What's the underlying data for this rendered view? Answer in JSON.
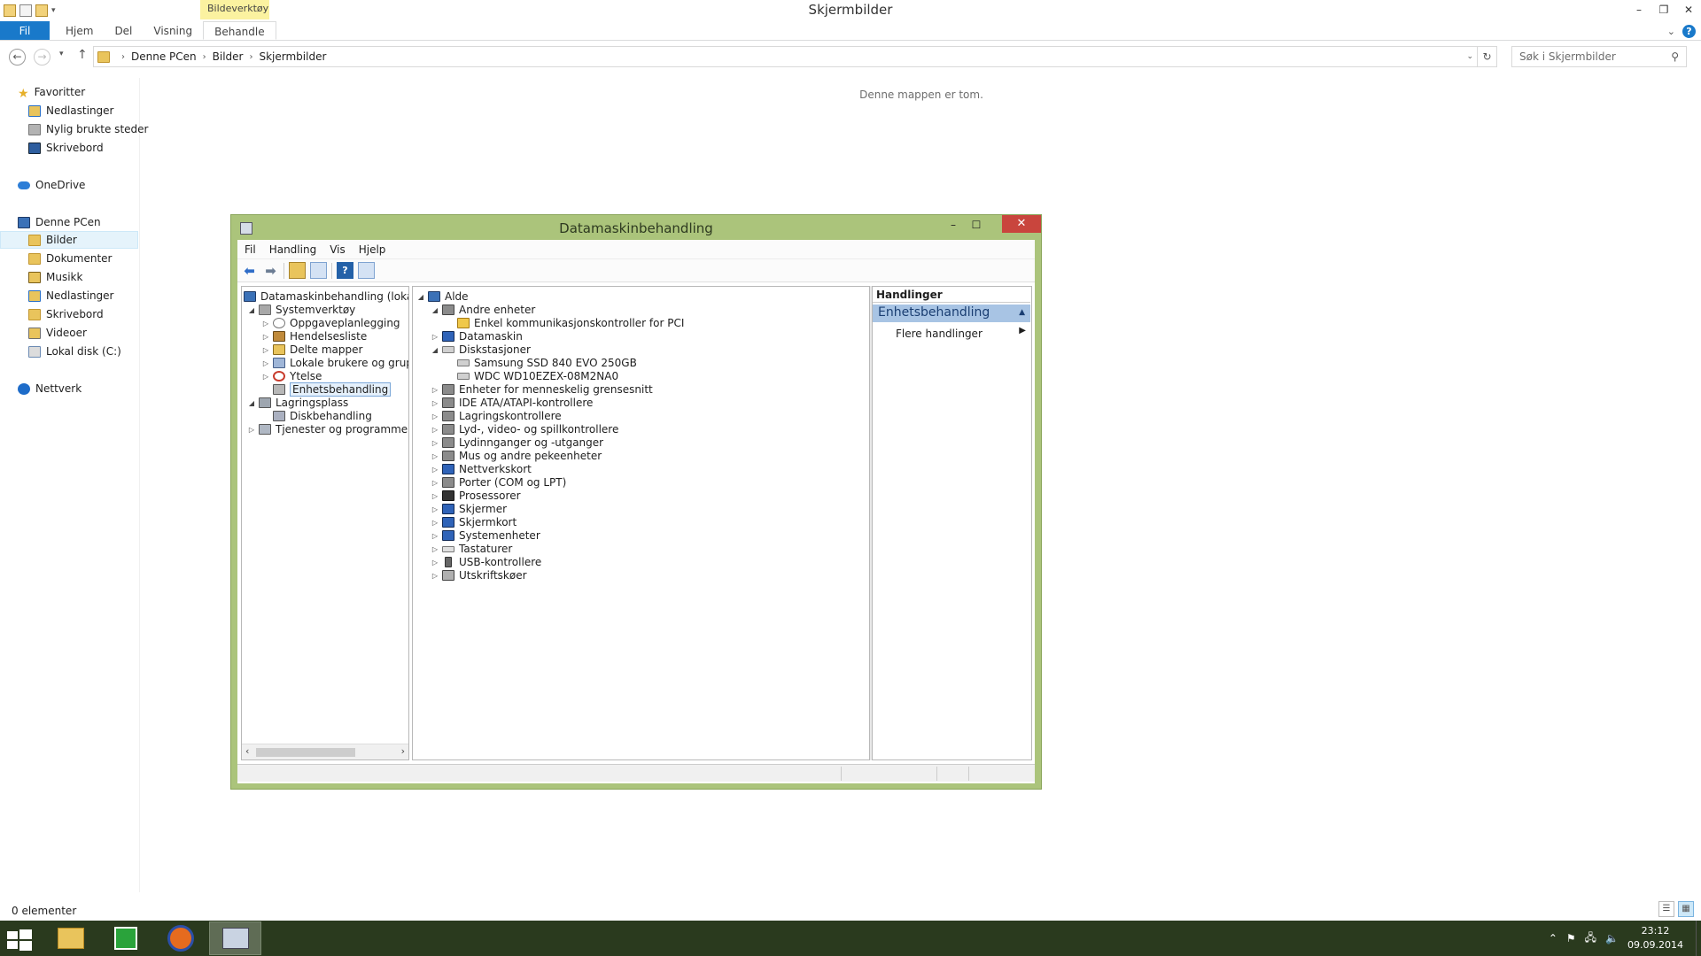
{
  "explorer": {
    "title": "Skjermbilder",
    "context_tab": "Bildeverktøy",
    "ribbon_tabs": [
      "Fil",
      "Hjem",
      "Del",
      "Visning",
      "Behandle"
    ],
    "breadcrumb": [
      "Denne PCen",
      "Bilder",
      "Skjermbilder"
    ],
    "search_placeholder": "Søk i Skjermbilder",
    "empty_message": "Denne mappen er tom.",
    "status": "0 elementer",
    "nav": {
      "favorites": "Favoritter",
      "downloads": "Nedlastinger",
      "recent": "Nylig brukte steder",
      "desktop": "Skrivebord",
      "onedrive": "OneDrive",
      "thispc": "Denne PCen",
      "pictures": "Bilder",
      "documents": "Dokumenter",
      "music": "Musikk",
      "downloads2": "Nedlastinger",
      "desktop2": "Skrivebord",
      "videos": "Videoer",
      "localdisk": "Lokal disk (C:)",
      "network": "Nettverk"
    }
  },
  "cm": {
    "title": "Datamaskinbehandling",
    "menu": [
      "Fil",
      "Handling",
      "Vis",
      "Hjelp"
    ],
    "tree": {
      "root": "Datamaskinbehandling (lokal)",
      "systools": "Systemverktøy",
      "scheduler": "Oppgaveplanlegging",
      "eventlog": "Hendelsesliste",
      "shared": "Delte mapper",
      "localusers": "Lokale brukere og grupp",
      "perf": "Ytelse",
      "devmgr": "Enhetsbehandling",
      "storage": "Lagringsplass",
      "diskmgmt": "Diskbehandling",
      "services": "Tjenester og programmer"
    },
    "devices": {
      "root": "Alde",
      "other": "Andre enheter",
      "pci": "Enkel kommunikasjonskontroller for PCI",
      "computer": "Datamaskin",
      "drives": "Diskstasjoner",
      "ssd": "Samsung SSD 840 EVO 250GB",
      "wdc": "WDC WD10EZEX-08M2NA0",
      "hid": "Enheter for menneskelig grensesnitt",
      "ide": "IDE ATA/ATAPI-kontrollere",
      "storagectl": "Lagringskontrollere",
      "sound": "Lyd-, video- og spillkontrollere",
      "audio": "Lydinnganger og -utganger",
      "mice": "Mus og andre pekeenheter",
      "network": "Nettverkskort",
      "ports": "Porter (COM og LPT)",
      "cpu": "Prosessorer",
      "monitors": "Skjermer",
      "display": "Skjermkort",
      "sysdev": "Systemenheter",
      "keyboards": "Tastaturer",
      "usb": "USB-kontrollere",
      "printq": "Utskriftskøer"
    },
    "actions": {
      "header": "Handlinger",
      "section": "Enhetsbehandling",
      "more": "Flere handlinger"
    }
  },
  "taskbar": {
    "time": "23:12",
    "date": "09.09.2014"
  }
}
